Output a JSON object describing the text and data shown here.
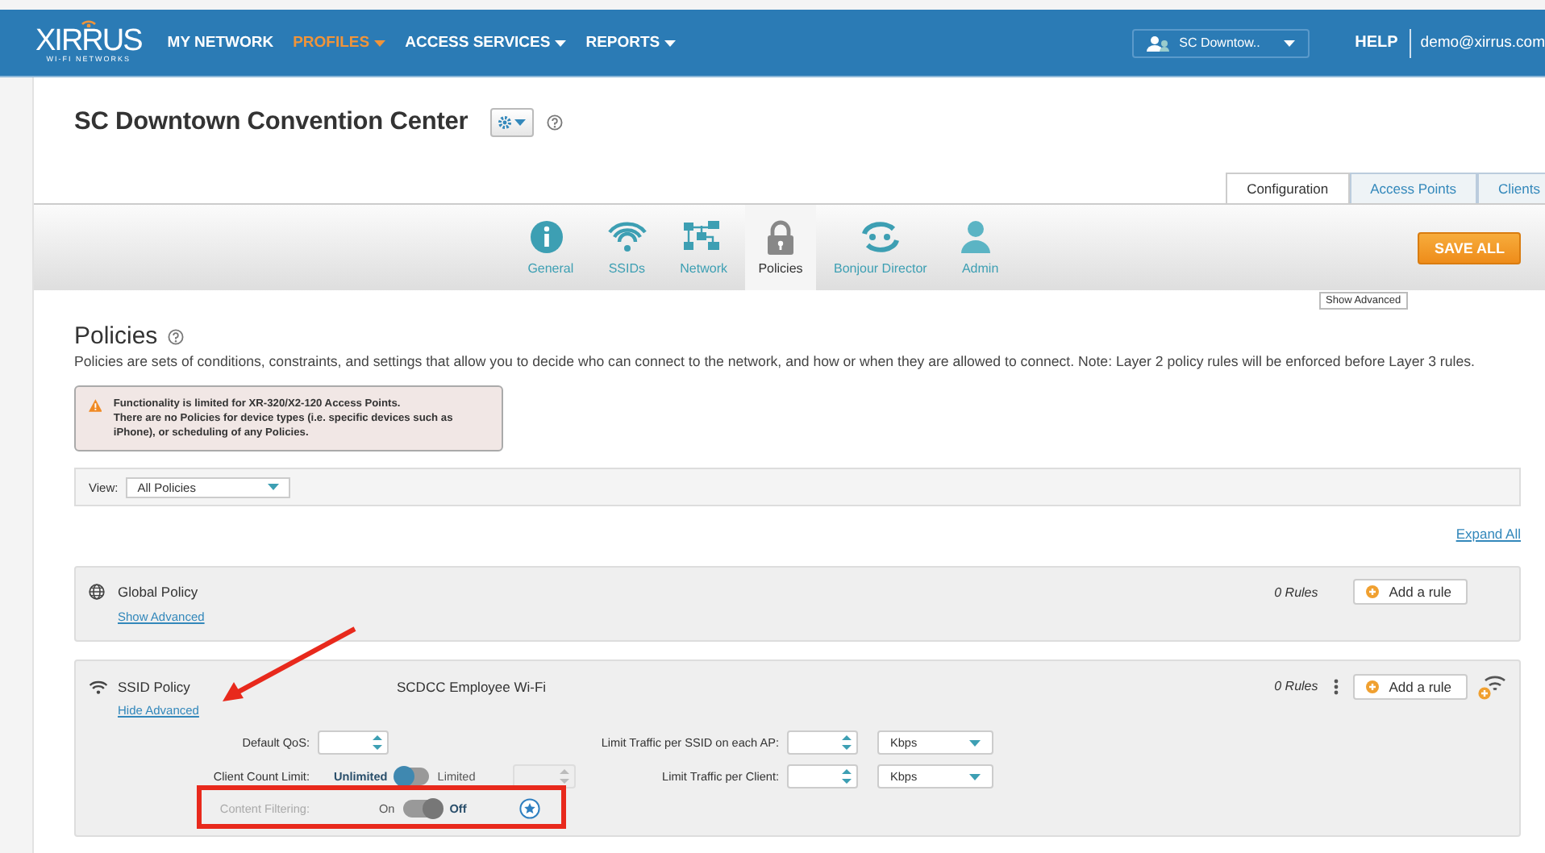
{
  "header": {
    "logo": {
      "name": "XIRRUS",
      "tagline": "WI-FI NETWORKS"
    },
    "menu": [
      {
        "label": "MY NETWORK",
        "selected": false,
        "dropdown": false
      },
      {
        "label": "PROFILES",
        "selected": true,
        "dropdown": true
      },
      {
        "label": "ACCESS SERVICES",
        "selected": false,
        "dropdown": true
      },
      {
        "label": "REPORTS",
        "selected": false,
        "dropdown": true
      }
    ],
    "profile_selector": "SC Downtow..",
    "help": "HELP",
    "user": "demo@xirrus.com"
  },
  "page": {
    "title": "SC Downtown Convention Center"
  },
  "view_tabs": [
    {
      "label": "Configuration",
      "selected": true
    },
    {
      "label": "Access Points",
      "selected": false
    },
    {
      "label": "Clients",
      "selected": false
    }
  ],
  "sections": [
    {
      "label": "General",
      "kind": "info",
      "selected": false
    },
    {
      "label": "SSIDs",
      "kind": "wifi",
      "selected": false
    },
    {
      "label": "Network",
      "kind": "network",
      "selected": false
    },
    {
      "label": "Policies",
      "kind": "lock",
      "selected": true
    },
    {
      "label": "Bonjour Director",
      "kind": "bonjour",
      "selected": false
    },
    {
      "label": "Admin",
      "kind": "user",
      "selected": false
    }
  ],
  "save_button": "SAVE ALL",
  "tooltip": "Show Advanced",
  "policies": {
    "heading": "Policies",
    "description": "Policies are sets of conditions, constraints, and settings that allow you to decide who can connect to the network, and how or when they are allowed to connect. Note: Layer 2 policy rules will be enforced before Layer 3 rules.",
    "warning": [
      "Functionality is limited for XR-320/X2-120 Access Points.",
      "There are no Policies for device types (i.e. specific devices such as iPhone), or scheduling of any Policies."
    ],
    "view_label": "View:",
    "view_value": "All Policies",
    "expand_all": "Expand All",
    "items": [
      {
        "kind": "global",
        "name": "Global Policy",
        "rules": "0 Rules",
        "add_rule": "Add a rule",
        "advanced_link": "Show Advanced",
        "expanded": false
      },
      {
        "kind": "ssid",
        "name": "SSID Policy",
        "ssid": "SCDCC Employee Wi-Fi",
        "rules": "0 Rules",
        "add_rule": "Add a rule",
        "advanced_link": "Hide Advanced",
        "expanded": true,
        "left_fields": [
          {
            "label": "Default QoS:",
            "kind": "spinner",
            "disabled": false
          },
          {
            "label": "Client Count Limit:",
            "kind": "toggle",
            "disabled": false,
            "options": [
              {
                "label": "Unlimited",
                "selected": true
              },
              {
                "label": "Limited",
                "selected": false
              }
            ],
            "limit_field": {
              "disabled": true
            }
          },
          {
            "label": "Content Filtering:",
            "kind": "toggle",
            "disabled": true,
            "options": [
              {
                "label": "On",
                "selected": false
              },
              {
                "label": "Off",
                "selected": true
              }
            ],
            "star_button": true
          }
        ],
        "right_fields": [
          {
            "label": "Limit Traffic per SSID on each AP:",
            "kind": "rate",
            "unit": "Kbps"
          },
          {
            "label": "Limit Traffic per Client:",
            "kind": "rate",
            "unit": "Kbps"
          }
        ]
      }
    ]
  },
  "annotations": {
    "arrow": true,
    "highlight": true
  }
}
